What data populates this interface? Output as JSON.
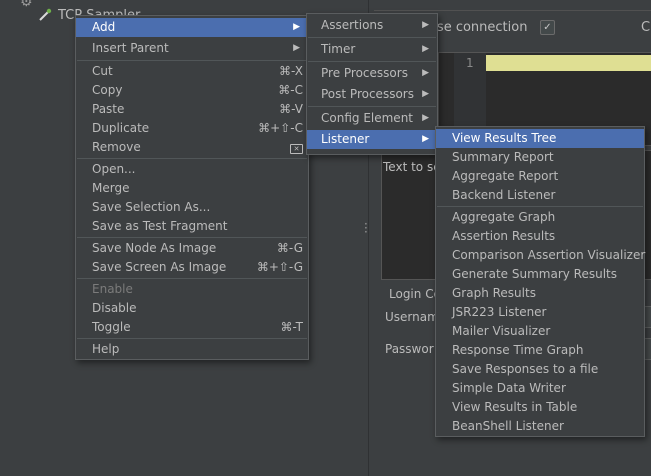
{
  "tree": {
    "selected_node": "TCP Sampler"
  },
  "panel": {
    "reuse_connection_label": "-use connection",
    "reuse_connection_checked": true,
    "right_clipped_label": "C",
    "editor_line_number": "1",
    "text_label": "Text to se",
    "login_label": "Login Co",
    "username_label": "Usernam",
    "password_label": "Passwor"
  },
  "context_menu": {
    "items": [
      {
        "label": "Add",
        "submenu": true,
        "selected": true
      },
      {
        "label": "Insert Parent",
        "submenu": true
      },
      {
        "label": "Cut",
        "shortcut": "⌘-X"
      },
      {
        "label": "Copy",
        "shortcut": "⌘-C"
      },
      {
        "label": "Paste",
        "shortcut": "⌘-V"
      },
      {
        "label": "Duplicate",
        "shortcut": "⌘+⇧-C"
      },
      {
        "label": "Remove",
        "shortcut_icon": "delete-key-icon"
      },
      {
        "label": "Open..."
      },
      {
        "label": "Merge"
      },
      {
        "label": "Save Selection As..."
      },
      {
        "label": "Save as Test Fragment"
      },
      {
        "label": "Save Node As Image",
        "shortcut": "⌘-G"
      },
      {
        "label": "Save Screen As Image",
        "shortcut": "⌘+⇧-G"
      },
      {
        "label": "Enable",
        "disabled": true
      },
      {
        "label": "Disable"
      },
      {
        "label": "Toggle",
        "shortcut": "⌘-T"
      },
      {
        "label": "Help"
      }
    ]
  },
  "add_submenu": {
    "items": [
      {
        "label": "Assertions"
      },
      {
        "label": "Timer"
      },
      {
        "label": "Pre Processors"
      },
      {
        "label": "Post Processors"
      },
      {
        "label": "Config Element"
      },
      {
        "label": "Listener",
        "selected": true
      }
    ]
  },
  "listener_submenu": {
    "items": [
      {
        "label": "View Results Tree",
        "selected": true
      },
      {
        "label": "Summary Report"
      },
      {
        "label": "Aggregate Report"
      },
      {
        "label": "Backend Listener"
      },
      {
        "label": "Aggregate Graph"
      },
      {
        "label": "Assertion Results"
      },
      {
        "label": "Comparison Assertion Visualizer"
      },
      {
        "label": "Generate Summary Results"
      },
      {
        "label": "Graph Results"
      },
      {
        "label": "JSR223 Listener"
      },
      {
        "label": "Mailer Visualizer"
      },
      {
        "label": "Response Time Graph"
      },
      {
        "label": "Save Responses to a file"
      },
      {
        "label": "Simple Data Writer"
      },
      {
        "label": "View Results in Table"
      },
      {
        "label": "BeanShell Listener"
      }
    ]
  },
  "colors": {
    "background": "#3c3f41",
    "selection": "#4b6eaf",
    "text": "#bbbbbb",
    "disabled_text": "#7b7b7b",
    "current_line": "#ffffa6"
  }
}
